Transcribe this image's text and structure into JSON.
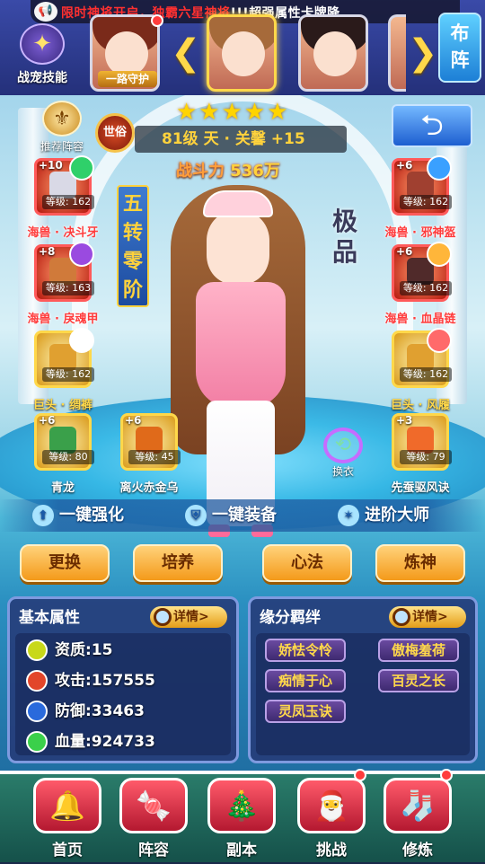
{
  "ticker": {
    "icon": "megaphone-icon",
    "text_red": "限时神将开启，独霸六星神将",
    "text_white": "!!!超强属性卡牌降"
  },
  "pet_skill": {
    "label": "战宠技能",
    "icon": "dragon-icon"
  },
  "portraits": [
    {
      "name": "hero-1",
      "tag": "",
      "hair": "#7a2a1a"
    },
    {
      "name": "hero-2",
      "tag": "一路守护",
      "hair": "#a66a3a",
      "selected": true
    },
    {
      "name": "hero-3",
      "tag": "",
      "hair": "#2a1a1a"
    },
    {
      "name": "hero-4",
      "tag": "",
      "hair": "#e0b060"
    }
  ],
  "formation_button": {
    "label_1": "布",
    "label_2": "阵"
  },
  "recommend": {
    "label": "推荐阵容"
  },
  "world_badge": {
    "label": "世俗"
  },
  "stars": "★★★★★",
  "hero_title": "81级 天 · 关馨 +15",
  "power": {
    "label": "战斗力",
    "value": "536万"
  },
  "back_button": {
    "icon": "back-arrow-icon",
    "symbol": "⮌"
  },
  "rank_label": "五转零阶",
  "rank_chars": [
    "五",
    "转",
    "零",
    "阶"
  ],
  "quality_label": "极品",
  "quality_chars": [
    "极",
    "品"
  ],
  "equipment_left": [
    {
      "plus": "+10",
      "level": "等级: 162",
      "name": "海兽 · 决斗牙",
      "gem": "#2fd06a",
      "style": "red"
    },
    {
      "plus": "+8",
      "level": "等级: 163",
      "name": "海兽 · 戾魂甲",
      "gem": "#9a4ae0",
      "style": "red"
    },
    {
      "plus": "",
      "level": "等级: 162",
      "name": "巨头 · 绸裤",
      "gem": "#ffffff",
      "style": "gold"
    },
    {
      "plus": "+6",
      "level": "等级: 80",
      "name": "青龙",
      "gem": "",
      "style": "green"
    },
    {
      "plus": "+6",
      "level": "等级: 45",
      "name": "离火赤金乌",
      "gem": "",
      "style": "green"
    }
  ],
  "equipment_right": [
    {
      "plus": "+6",
      "level": "等级: 162",
      "name": "海兽 · 邪神盔",
      "gem": "#3aa0ff",
      "style": "red"
    },
    {
      "plus": "+6",
      "level": "等级: 162",
      "name": "海兽 · 血晶链",
      "gem": "#ffb63a",
      "style": "red"
    },
    {
      "plus": "",
      "level": "等级: 162",
      "name": "巨头 · 风履",
      "gem": "#ff6a6a",
      "style": "gold"
    },
    {
      "plus": "+3",
      "level": "等级: 79",
      "name": "先蚕驱风诀",
      "gem": "",
      "style": "green"
    }
  ],
  "swap": {
    "label": "换衣"
  },
  "actions": {
    "strengthen": "一键强化",
    "equip": "一键装备",
    "advance": "进阶大师"
  },
  "buttons": {
    "replace": "更换",
    "train": "培养",
    "mind": "心法",
    "refine": "炼神"
  },
  "attributes": {
    "title": "基本属性",
    "detail": "详情>",
    "items": [
      {
        "label": "资质:15",
        "color": "#c8d81a"
      },
      {
        "label": "攻击:157555",
        "color": "#e2452a"
      },
      {
        "label": "防御:33463",
        "color": "#2a6adc"
      },
      {
        "label": "血量:924733",
        "color": "#3ad04a"
      }
    ]
  },
  "fate": {
    "title": "缘分羁绊",
    "detail": "详情>",
    "items": [
      "娇怯令怜",
      "傲梅羞荷",
      "痴情于心",
      "百灵之长",
      "灵凤玉诀"
    ]
  },
  "nav": [
    {
      "label": "首页",
      "icon": "bell-icon",
      "glyph": "🔔",
      "dot": false
    },
    {
      "label": "阵容",
      "icon": "candy-cane-icon",
      "glyph": "🍬",
      "dot": false
    },
    {
      "label": "副本",
      "icon": "christmas-tree-icon",
      "glyph": "🎄",
      "dot": false
    },
    {
      "label": "挑战",
      "icon": "santa-hat-icon",
      "glyph": "🎅",
      "dot": true
    },
    {
      "label": "修炼",
      "icon": "stocking-icon",
      "glyph": "🧦",
      "dot": true
    }
  ]
}
